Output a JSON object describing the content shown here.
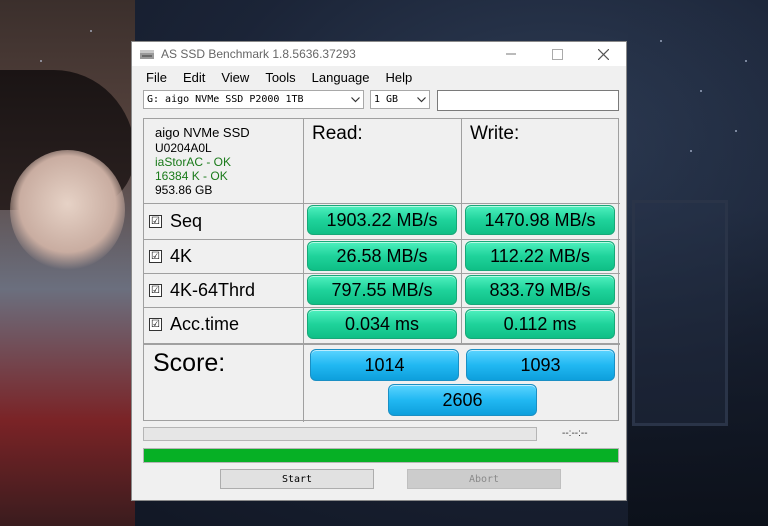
{
  "window": {
    "title": "AS SSD Benchmark 1.8.5636.37293"
  },
  "menu": [
    "File",
    "Edit",
    "View",
    "Tools",
    "Language",
    "Help"
  ],
  "toolbar": {
    "drive_select": "G: aigo NVMe SSD P2000 1TB",
    "size_select": "1 GB",
    "text_value": ""
  },
  "device": {
    "name": "aigo NVMe SSD",
    "firmware": "U0204A0L",
    "driver_status": "iaStorAC - OK",
    "alignment_status": "16384 K - OK",
    "capacity": "953.86 GB"
  },
  "columns": {
    "read": "Read:",
    "write": "Write:"
  },
  "rows": [
    {
      "check": "☑",
      "label": "Seq",
      "read": "1903.22 MB/s",
      "write": "1470.98 MB/s"
    },
    {
      "check": "☑",
      "label": "4K",
      "read": "26.58 MB/s",
      "write": "112.22 MB/s"
    },
    {
      "check": "☑",
      "label": "4K-64Thrd",
      "read": "797.55 MB/s",
      "write": "833.79 MB/s"
    },
    {
      "check": "☑",
      "label": "Acc.time",
      "read": "0.034 ms",
      "write": "0.112 ms"
    }
  ],
  "score": {
    "label": "Score:",
    "read": "1014",
    "write": "1093",
    "total": "2606"
  },
  "status": {
    "time": "--:--:--",
    "test_progress": 0,
    "overall_progress": 1.0
  },
  "buttons": {
    "start": "Start",
    "abort": "Abort"
  },
  "colors": {
    "result_box": "#1fd39b",
    "score_box": "#21b8f2",
    "progress_fill": "#06b025"
  }
}
